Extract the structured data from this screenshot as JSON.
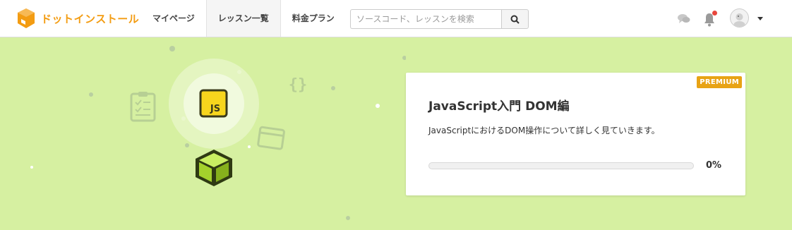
{
  "header": {
    "logo_text": "ドットインストール",
    "nav": [
      {
        "label": "マイページ"
      },
      {
        "label": "レッスン一覧"
      },
      {
        "label": "料金プラン"
      }
    ],
    "search": {
      "placeholder": "ソースコード、レッスンを検索",
      "value": ""
    },
    "icons": [
      "chat-icon",
      "bell-icon",
      "avatar",
      "caret-down-icon"
    ],
    "notification_dot_color": "#e8453c"
  },
  "card": {
    "badge": "PREMIUM",
    "title": "JavaScript入門 DOM編",
    "description": "JavaScriptにおけるDOM操作について詳しく見ていきます。",
    "progress_percent": 0,
    "progress_text": "0%"
  },
  "illustration": {
    "js_badge": "JS",
    "icons": [
      "clipboard-icon",
      "js-icon",
      "braces-icon",
      "browser-window-icon",
      "cube-icon"
    ]
  },
  "colors": {
    "brand": "#f39c12",
    "background": "#d6f0a1",
    "badge": "#e8a315"
  }
}
